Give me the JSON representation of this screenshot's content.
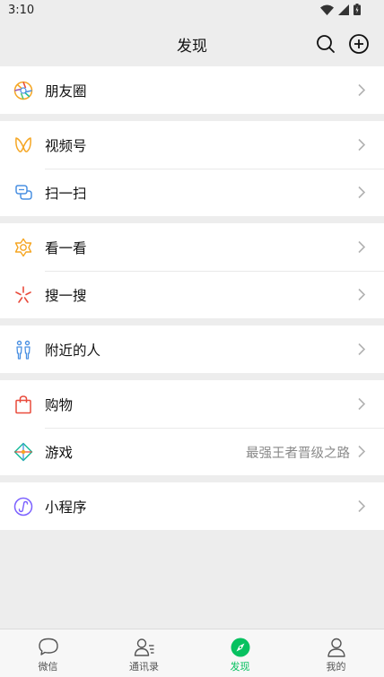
{
  "status": {
    "time": "3:10"
  },
  "nav": {
    "title": "发现"
  },
  "groups": [
    {
      "rows": [
        {
          "label": "朋友圈",
          "icon": "moments-icon"
        }
      ]
    },
    {
      "rows": [
        {
          "label": "视频号",
          "icon": "channels-icon"
        },
        {
          "label": "扫一扫",
          "icon": "scan-icon"
        }
      ]
    },
    {
      "rows": [
        {
          "label": "看一看",
          "icon": "top-stories-icon"
        },
        {
          "label": "搜一搜",
          "icon": "search-sparkle-icon"
        }
      ]
    },
    {
      "rows": [
        {
          "label": "附近的人",
          "icon": "people-nearby-icon"
        }
      ]
    },
    {
      "rows": [
        {
          "label": "购物",
          "icon": "shopping-bag-icon"
        },
        {
          "label": "游戏",
          "icon": "games-icon",
          "extra": "最强王者晋级之路"
        }
      ]
    },
    {
      "rows": [
        {
          "label": "小程序",
          "icon": "mini-programs-icon"
        }
      ]
    }
  ],
  "tabs": [
    {
      "label": "微信",
      "icon": "chat-bubble-icon",
      "active": false
    },
    {
      "label": "通讯录",
      "icon": "contacts-icon",
      "active": false
    },
    {
      "label": "发现",
      "icon": "compass-icon",
      "active": true
    },
    {
      "label": "我的",
      "icon": "person-icon",
      "active": false
    }
  ],
  "colors": {
    "active_tab": "#07c160",
    "background": "#ededed"
  }
}
